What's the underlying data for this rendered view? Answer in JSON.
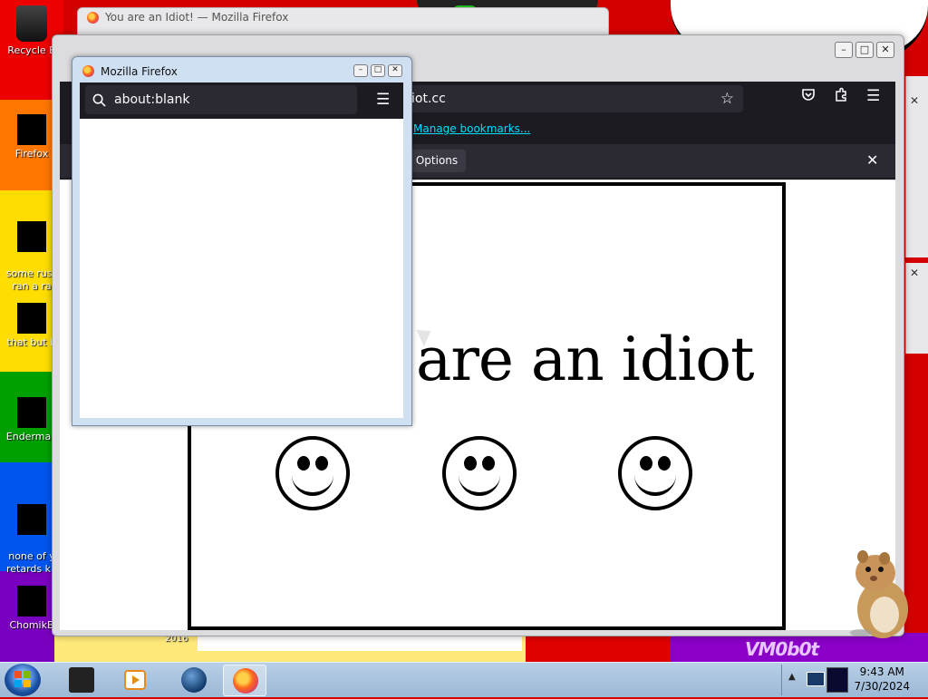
{
  "desktop": {
    "icons": [
      {
        "label": "Recycle B",
        "icon": "recycle-bin-icon"
      },
      {
        "label": "Firefox",
        "icon": "firefox-icon"
      },
      {
        "label": "some russ\nran a ra",
        "icon": "file-icon"
      },
      {
        "label": "that but it",
        "icon": "file-icon"
      },
      {
        "label": "Enderman",
        "icon": "file-icon"
      },
      {
        "label": "none of y\nretards kn",
        "icon": "file-icon"
      },
      {
        "label": "ChomikB",
        "icon": "file-icon"
      }
    ],
    "watermark": "VM0b0t",
    "bottom_number": "2016"
  },
  "back_window": {
    "title": "You are an Idiot! — Mozilla Firefox"
  },
  "main_window": {
    "url_fragment": "iot.cc",
    "manage_bookmarks": "Manage bookmarks...",
    "notification_options": "Options",
    "page_text": "are an idiot",
    "smiley_count": 3
  },
  "front_window": {
    "title": "Mozilla Firefox",
    "url": "about:blank"
  },
  "taskbar": {
    "time": "9:43 AM",
    "date": "7/30/2024",
    "items": [
      "terminal-app",
      "media-player-app",
      "globe-app",
      "firefox-app"
    ]
  },
  "colors": {
    "firefox_toolbar": "#1c1b22",
    "link": "#00ddff",
    "wallpaper_red": "#e00000",
    "wallpaper_purple": "#8a00c8"
  }
}
